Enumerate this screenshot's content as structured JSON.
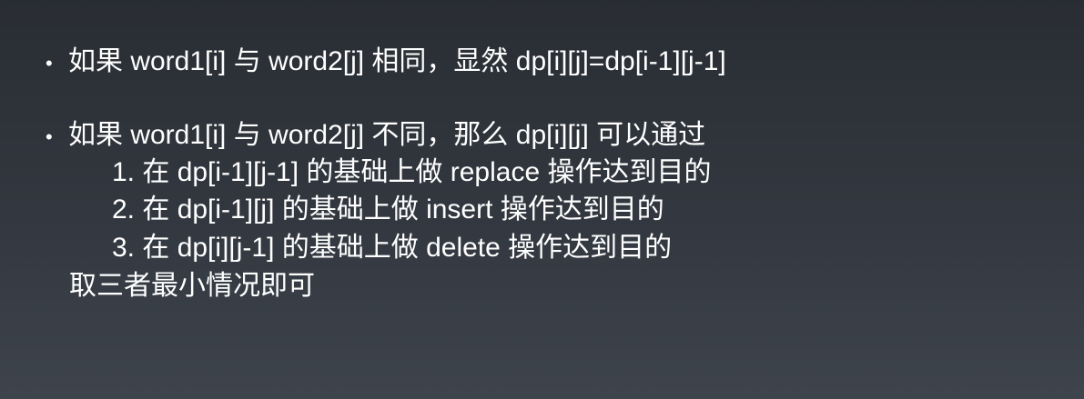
{
  "slide": {
    "bullet_symbol": "•",
    "line1": "如果 word1[i] 与 word2[j] 相同，显然 dp[i][j]=dp[i-1][j-1]",
    "line2": "如果 word1[i] 与 word2[j] 不同，那么 dp[i][j] 可以通过",
    "steps": [
      "1. 在 dp[i-1][j-1] 的基础上做 replace 操作达到目的",
      "2. 在 dp[i-1][j] 的基础上做 insert 操作达到目的",
      "3. 在 dp[i][j-1] 的基础上做 delete 操作达到目的"
    ],
    "conclusion": "取三者最小情况即可"
  }
}
